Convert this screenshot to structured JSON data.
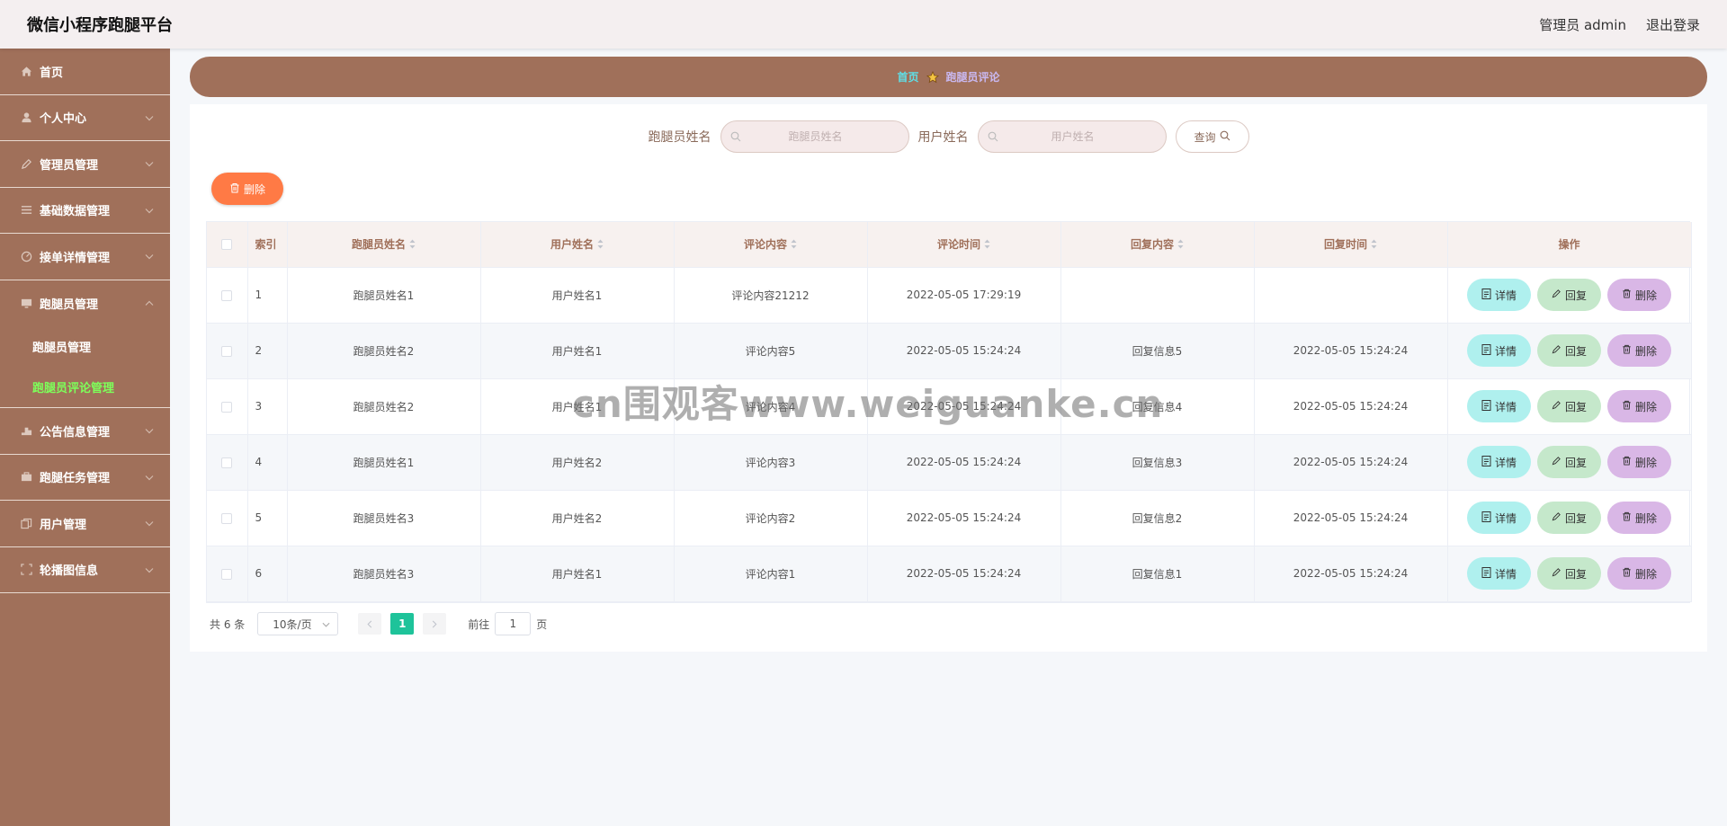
{
  "header": {
    "app_title": "微信小程序跑腿平台",
    "admin_label": "管理员 admin",
    "logout_label": "退出登录"
  },
  "sidebar": {
    "items": [
      {
        "label": "首页",
        "icon": "home-icon"
      },
      {
        "label": "个人中心",
        "icon": "user-icon"
      },
      {
        "label": "管理员管理",
        "icon": "pen-icon"
      },
      {
        "label": "基础数据管理",
        "icon": "list-icon"
      },
      {
        "label": "接单详情管理",
        "icon": "gauge-icon"
      },
      {
        "label": "跑腿员管理",
        "icon": "monitor-icon"
      },
      {
        "label": "公告信息管理",
        "icon": "megaphone-icon"
      },
      {
        "label": "跑腿任务管理",
        "icon": "briefcase-icon"
      },
      {
        "label": "用户管理",
        "icon": "copy-icon"
      },
      {
        "label": "轮播图信息",
        "icon": "fullscreen-icon"
      }
    ],
    "subitems": [
      {
        "label": "跑腿员管理"
      },
      {
        "label": "跑腿员评论管理"
      }
    ]
  },
  "breadcrumb": {
    "home": "首页",
    "current": "跑腿员评论"
  },
  "search": {
    "runner_label": "跑腿员姓名",
    "runner_placeholder": "跑腿员姓名",
    "user_label": "用户姓名",
    "user_placeholder": "用户姓名",
    "query_label": "查询"
  },
  "toolbar": {
    "delete_label": "删除"
  },
  "table": {
    "headers": {
      "index": "索引",
      "runner": "跑腿员姓名",
      "user": "用户姓名",
      "comment": "评论内容",
      "comment_time": "评论时间",
      "reply": "回复内容",
      "reply_time": "回复时间",
      "ops": "操作"
    },
    "op_labels": {
      "detail": "详情",
      "reply": "回复",
      "delete": "删除"
    },
    "rows": [
      {
        "index": "1",
        "runner": "跑腿员姓名1",
        "user": "用户姓名1",
        "comment": "评论内容21212",
        "comment_time": "2022-05-05 17:29:19",
        "reply": "",
        "reply_time": ""
      },
      {
        "index": "2",
        "runner": "跑腿员姓名2",
        "user": "用户姓名1",
        "comment": "评论内容5",
        "comment_time": "2022-05-05 15:24:24",
        "reply": "回复信息5",
        "reply_time": "2022-05-05 15:24:24"
      },
      {
        "index": "3",
        "runner": "跑腿员姓名2",
        "user": "用户姓名1",
        "comment": "评论内容4",
        "comment_time": "2022-05-05 15:24:24",
        "reply": "回复信息4",
        "reply_time": "2022-05-05 15:24:24"
      },
      {
        "index": "4",
        "runner": "跑腿员姓名1",
        "user": "用户姓名2",
        "comment": "评论内容3",
        "comment_time": "2022-05-05 15:24:24",
        "reply": "回复信息3",
        "reply_time": "2022-05-05 15:24:24"
      },
      {
        "index": "5",
        "runner": "跑腿员姓名3",
        "user": "用户姓名2",
        "comment": "评论内容2",
        "comment_time": "2022-05-05 15:24:24",
        "reply": "回复信息2",
        "reply_time": "2022-05-05 15:24:24"
      },
      {
        "index": "6",
        "runner": "跑腿员姓名3",
        "user": "用户姓名1",
        "comment": "评论内容1",
        "comment_time": "2022-05-05 15:24:24",
        "reply": "回复信息1",
        "reply_time": "2022-05-05 15:24:24"
      }
    ]
  },
  "pagination": {
    "total": "共 6 条",
    "page_size": "10条/页",
    "current_page": "1",
    "goto_prefix": "前往",
    "goto_value": "1",
    "goto_suffix": "页"
  },
  "watermark": "cn围观客www.weiguanke.cn",
  "colors": {
    "sidebar_bg": "#a0705a",
    "active_submenu": "#7dff5a",
    "delete_button": "#ff7a45",
    "page_active": "#1ec39a",
    "op_detail": "#aff0ee",
    "op_reply": "#c5e8cb",
    "op_delete": "#d9b7e6"
  }
}
